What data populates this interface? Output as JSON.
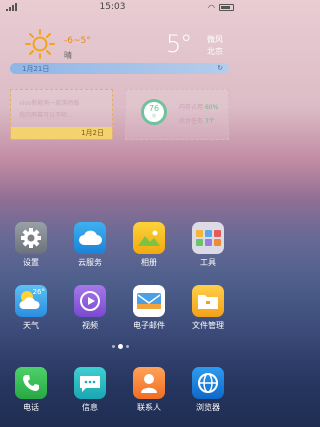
{
  "status": {
    "time": "15:03"
  },
  "weather": {
    "temp_range": "-6~5°",
    "condition": "晴",
    "current_temp": "5°",
    "wind": "微风",
    "city": "北京",
    "date": "1月21日"
  },
  "calendar": {
    "line1": "vivo新能有一款英特版",
    "line2": "我的屏幕可以不吻...",
    "date": "1月2日"
  },
  "manager": {
    "score": "76",
    "score_unit": "分",
    "mem_label": "内存占用",
    "mem_value": "60%",
    "task_label": "后台任务",
    "task_value": "7个"
  },
  "apps": {
    "settings": "设置",
    "cloud": "云服务",
    "album": "相册",
    "tools": "工具",
    "weather": "天气",
    "video": "视频",
    "email": "电子邮件",
    "files": "文件管理",
    "phone": "电话",
    "messages": "信息",
    "contacts": "联系人",
    "browser": "浏览器"
  },
  "weather_icon_temp": "26°"
}
